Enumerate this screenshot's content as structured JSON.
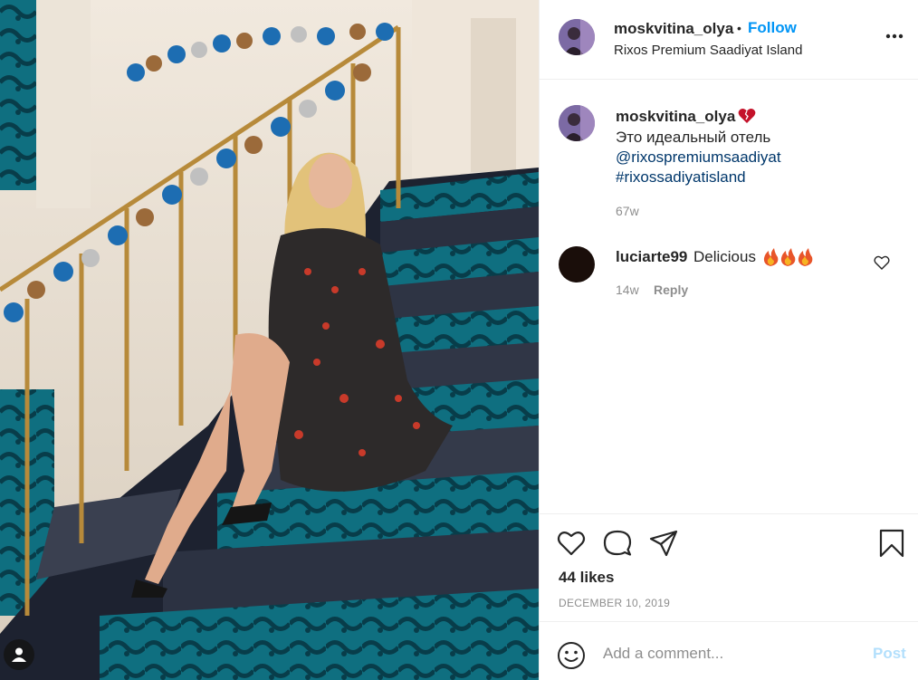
{
  "post": {
    "username": "moskvitina_olya",
    "follow_label": "Follow",
    "separator": "•",
    "location": "Rixos Premium Saadiyat Island"
  },
  "caption": {
    "username": "moskvitina_olya",
    "text": "Это идеальный отель",
    "mention": "@rixospremiumsaadiyat",
    "hashtag": "#rixossadiyatisland",
    "time": "67w"
  },
  "comment": {
    "username": "luciarte99",
    "text": "Delicious",
    "time": "14w",
    "reply_label": "Reply"
  },
  "stats": {
    "likes": "44 likes",
    "date": "DECEMBER 10, 2019"
  },
  "composer": {
    "placeholder": "Add a comment...",
    "post_label": "Post"
  },
  "colors": {
    "link": "#0095f6",
    "mention": "#00376b",
    "muted": "#8e8e8e",
    "post_disabled": "#b2dffc"
  },
  "icons": [
    "more-options-icon",
    "broken-heart-emoji",
    "fire-emoji",
    "heart-icon",
    "comment-icon",
    "share-icon",
    "bookmark-icon",
    "smiley-icon",
    "user-tag-icon"
  ]
}
